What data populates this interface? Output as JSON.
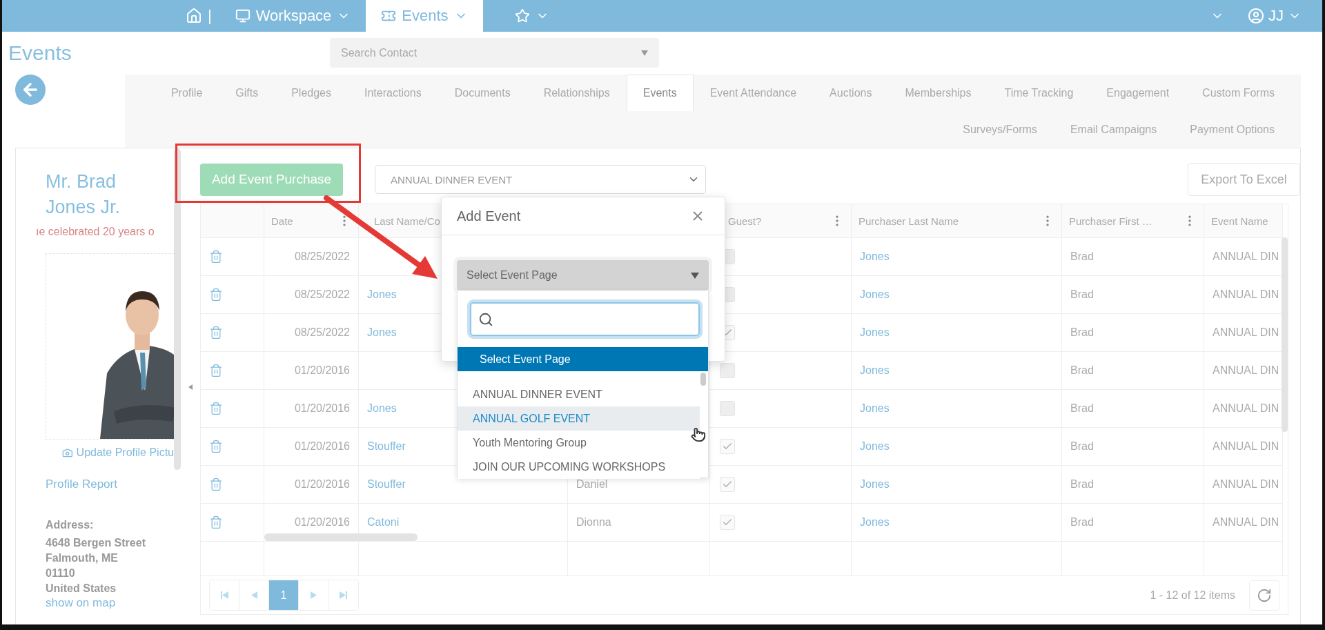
{
  "top_nav": {
    "separator": "|",
    "items": [
      {
        "kind": "workspace",
        "label": "Workspace",
        "selected": false
      },
      {
        "kind": "events",
        "label": "Events",
        "selected": true
      }
    ],
    "user": "JJ"
  },
  "page_title": "Events",
  "search": {
    "placeholder": "Search Contact"
  },
  "tab_rows": [
    [
      {
        "label": "Profile",
        "selected": false
      },
      {
        "label": "Gifts",
        "selected": false
      },
      {
        "label": "Pledges",
        "selected": false
      },
      {
        "label": "Interactions",
        "selected": false
      },
      {
        "label": "Documents",
        "selected": false
      },
      {
        "label": "Relationships",
        "selected": false
      },
      {
        "label": "Events",
        "selected": true
      },
      {
        "label": "Event Attendance",
        "selected": false
      },
      {
        "label": "Auctions",
        "selected": false
      },
      {
        "label": "Memberships",
        "selected": false
      },
      {
        "label": "Time Tracking",
        "selected": false
      },
      {
        "label": "Engagement",
        "selected": false
      },
      {
        "label": "Custom Forms",
        "selected": false
      }
    ],
    [
      {
        "label": "Surveys/Forms",
        "selected": false
      },
      {
        "label": "Email Campaigns",
        "selected": false
      },
      {
        "label": "Payment Options",
        "selected": false
      }
    ]
  ],
  "profile": {
    "name_lines": [
      "Mr. Brad",
      "Jones Jr."
    ],
    "note": "ıe celebrated 20 years o",
    "update_picture": "Update Profile Pictu",
    "report_link": "Profile Report",
    "address_label": "Address:",
    "address_lines": [
      "4648 Bergen Street",
      "Falmouth, ME",
      "01110",
      "United States"
    ],
    "map_link": "show on map"
  },
  "toolbar": {
    "add_button": "Add Event Purchase",
    "event_select": "ANNUAL DINNER EVENT",
    "export_button": "Export To Excel"
  },
  "table": {
    "columns": [
      {
        "label": "Date",
        "menu": true
      },
      {
        "label": "Last Name/Co"
      },
      {
        "label": "Guest?",
        "menu": true
      },
      {
        "label": "Purchaser Last Name",
        "menu": true
      },
      {
        "label": "Purchaser First …",
        "menu": true
      },
      {
        "label": "Event Name",
        "menu": false
      }
    ],
    "rows": [
      {
        "date": "08/25/2022",
        "last_name": "",
        "checked": false,
        "purchaser_last": "Jones",
        "purchaser_first": "Brad",
        "event": "ANNUAL DIN"
      },
      {
        "date": "08/25/2022",
        "last_name": "Jones",
        "checked": false,
        "purchaser_last": "Jones",
        "purchaser_first": "Brad",
        "event": "ANNUAL DIN"
      },
      {
        "date": "08/25/2022",
        "last_name": "Jones",
        "checked": true,
        "purchaser_last": "Jones",
        "purchaser_first": "Brad",
        "event": "ANNUAL DIN"
      },
      {
        "date": "01/20/2016",
        "last_name": "",
        "checked": false,
        "purchaser_last": "Jones",
        "purchaser_first": "Brad",
        "event": "ANNUAL DIN"
      },
      {
        "date": "01/20/2016",
        "last_name": "Jones",
        "checked": false,
        "purchaser_last": "Jones",
        "purchaser_first": "Brad",
        "event": "ANNUAL DIN"
      },
      {
        "date": "01/20/2016",
        "last_name": "Stouffer",
        "checked": true,
        "purchaser_last": "Jones",
        "purchaser_first": "Brad",
        "event": "ANNUAL DIN"
      },
      {
        "date": "01/20/2016",
        "last_name": "Stouffer",
        "first_name": "Daniel",
        "checked": true,
        "purchaser_last": "Jones",
        "purchaser_first": "Brad",
        "event": "ANNUAL DIN"
      },
      {
        "date": "01/20/2016",
        "last_name": "Catoni",
        "first_name": "Dionna",
        "checked": true,
        "purchaser_last": "Jones",
        "purchaser_first": "Brad",
        "event": "ANNUAL DIN"
      }
    ]
  },
  "pager": {
    "pages": [
      {
        "label": "1",
        "selected": true
      }
    ],
    "summary": "1 - 12 of 12 items"
  },
  "modal": {
    "title": "Add Event",
    "select": "Select Event Page",
    "options": [
      {
        "label": "Select Event Page",
        "selected": true,
        "hovered": false
      },
      {
        "label": "ANNUAL DINNER EVENT",
        "selected": false,
        "hovered": false
      },
      {
        "label": "ANNUAL GOLF EVENT",
        "selected": false,
        "hovered": true
      },
      {
        "label": "Youth Mentoring Group",
        "selected": false,
        "hovered": false
      },
      {
        "label": "JOIN OUR UPCOMING WORKSHOPS",
        "selected": false,
        "hovered": false
      }
    ]
  }
}
